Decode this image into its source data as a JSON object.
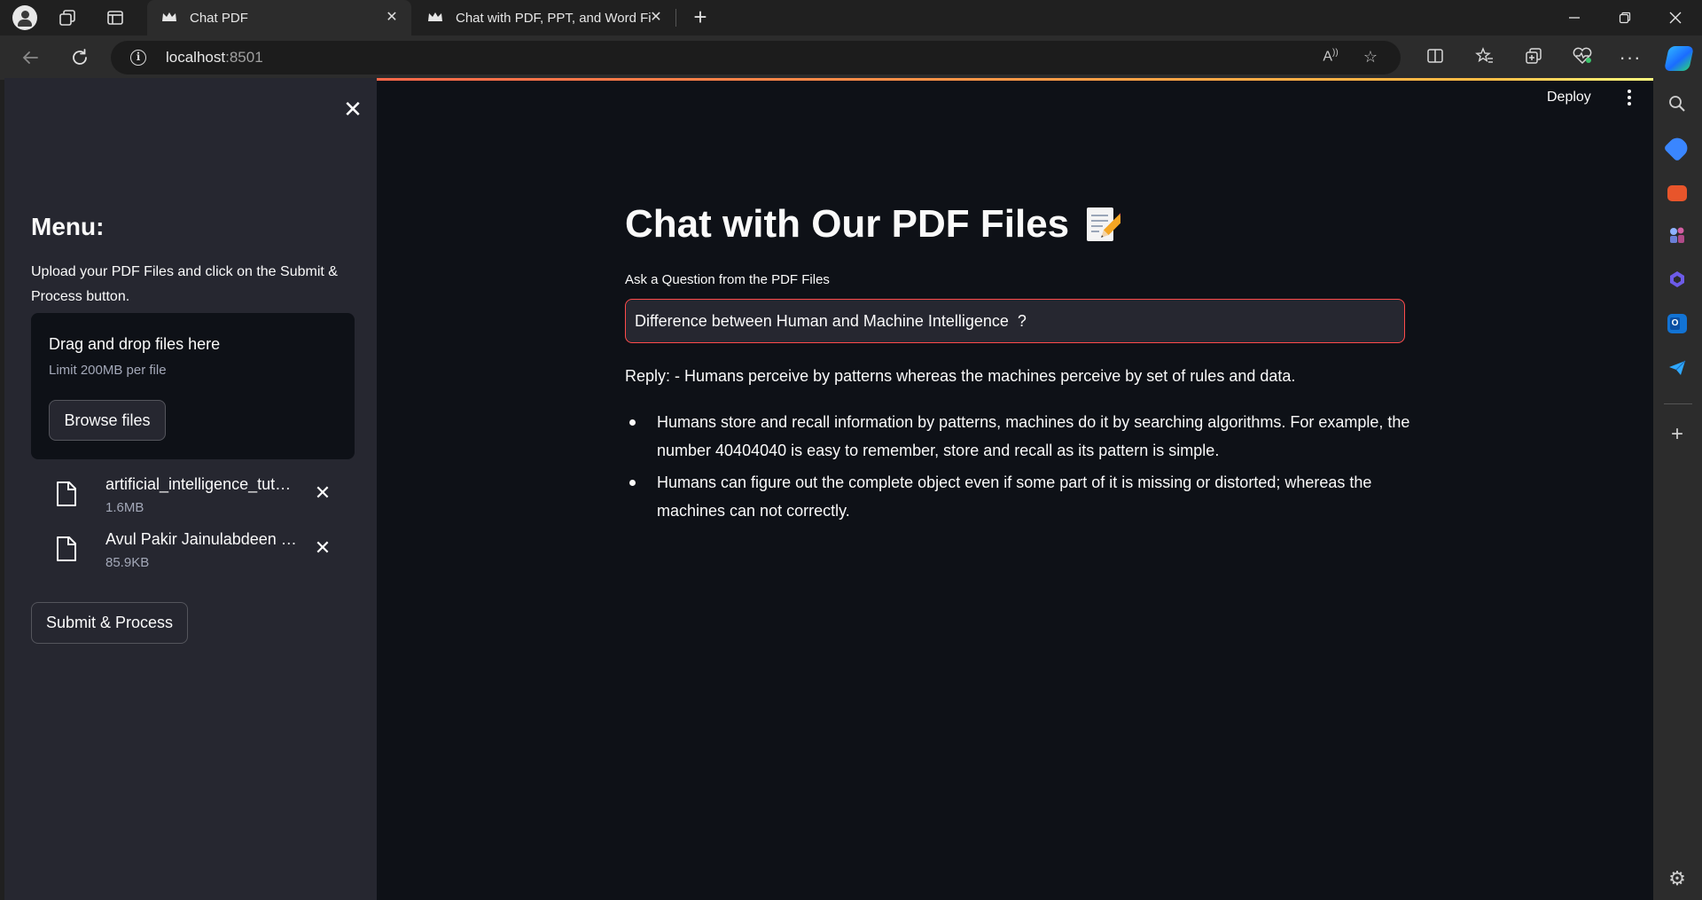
{
  "browser": {
    "tabs": [
      {
        "title": "Chat PDF",
        "active": true
      },
      {
        "title": "Chat with PDF, PPT, and Word Fil",
        "active": false
      }
    ],
    "url_host": "localhost",
    "url_port": ":8501"
  },
  "header": {
    "deploy_label": "Deploy"
  },
  "sidebar": {
    "heading": "Menu:",
    "description": "Upload your PDF Files and click on the Submit & Process button.",
    "dropzone": {
      "title": "Drag and drop files here",
      "limit": "Limit 200MB per file",
      "browse_label": "Browse files"
    },
    "files": [
      {
        "name": "artificial_intelligence_tut…",
        "size": "1.6MB"
      },
      {
        "name": "Avul Pakir Jainulabdeen …",
        "size": "85.9KB"
      }
    ],
    "submit_label": "Submit & Process"
  },
  "main": {
    "title": "Chat with Our PDF Files",
    "question_label": "Ask a Question from the PDF Files",
    "question_value": "Difference between Human and Machine Intelligence  ?",
    "reply": "Reply: - Humans perceive by patterns whereas the machines perceive by set of rules and data.",
    "bullets": [
      "Humans store and recall information by patterns, machines do it by searching algorithms. For example, the number 40404040 is easy to remember, store and recall as its pattern is simple.",
      "Humans can figure out the complete object even if some part of it is missing or distorted; whereas the machines can not correctly."
    ]
  },
  "colors": {
    "app_bg": "#0e1117",
    "sidebar_bg": "#262730",
    "accent": "#ff4b4b"
  }
}
